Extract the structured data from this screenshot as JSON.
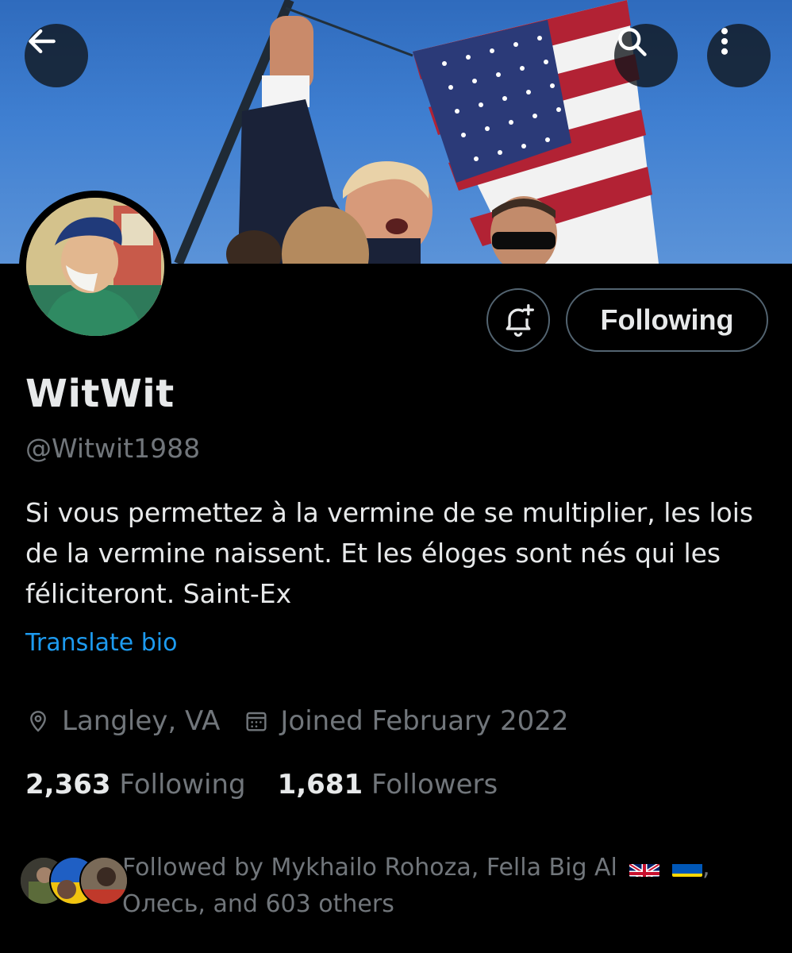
{
  "profile": {
    "display_name": "WitWit",
    "handle": "@Witwit1988",
    "bio": "Si vous permettez à la vermine de se multiplier, les lois de la vermine naissent. Et les éloges sont nés qui les féliciteront. Saint-Ex",
    "translate_label": "Translate bio",
    "location": "Langley, VA",
    "joined": "Joined February 2022"
  },
  "actions": {
    "following_label": "Following"
  },
  "stats": {
    "following_count": "2,363",
    "following_label": "Following",
    "followers_count": "1,681",
    "followers_label": "Followers"
  },
  "followed_by": {
    "prefix": "Followed by Mykhailo Rohoza, Fella Big Al",
    "suffix_after_flags": ",",
    "line2": "Олесь, and 603 others"
  },
  "icons": {
    "back": "arrow-left-icon",
    "search": "search-icon",
    "more": "more-vertical-icon",
    "bell": "bell-plus-icon",
    "location": "location-pin-icon",
    "calendar": "calendar-icon"
  },
  "colors": {
    "background": "#000000",
    "text": "#e7e9ea",
    "secondary": "#71767b",
    "link": "#1d9bf0",
    "border": "#536471"
  }
}
